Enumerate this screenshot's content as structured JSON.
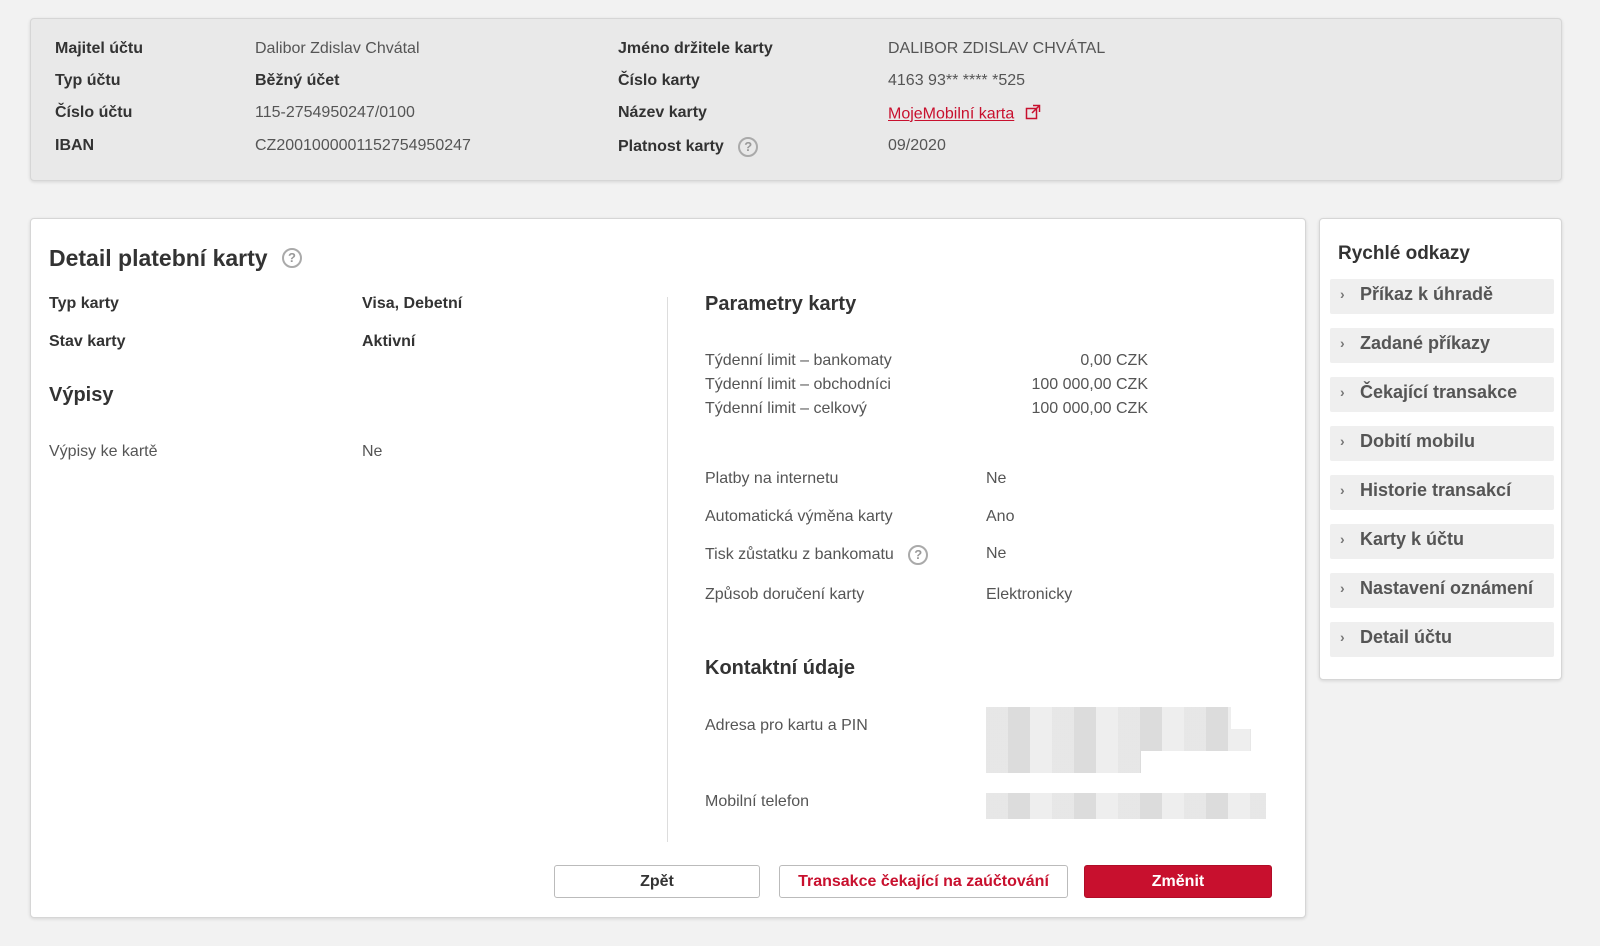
{
  "summary": {
    "owner_label": "Majitel účtu",
    "owner_value": "Dalibor Zdislav Chvátal",
    "type_label": "Typ účtu",
    "type_value": "Běžný účet",
    "number_label": "Číslo účtu",
    "number_value": "115-2754950247/0100",
    "iban_label": "IBAN",
    "iban_value": "CZ2001000001152754950247",
    "holder_label": "Jméno držitele karty",
    "holder_value": "DALIBOR ZDISLAV CHVÁTAL",
    "card_number_label": "Číslo karty",
    "card_number_value": "4163 93** **** *525",
    "card_name_label": "Název karty",
    "card_name_value": "MojeMobilní karta",
    "validity_label": "Platnost karty",
    "validity_value": "09/2020",
    "help_glyph": "?"
  },
  "detail": {
    "title": "Detail platební karty",
    "card_type_label": "Typ karty",
    "card_type_value": "Visa, Debetní",
    "card_state_label": "Stav karty",
    "card_state_value": "Aktivní",
    "statements_heading": "Výpisy",
    "statements_label": "Výpisy ke kartě",
    "statements_value": "Ne",
    "params_heading": "Parametry karty",
    "limits": [
      {
        "label": "Týdenní limit – bankomaty",
        "value": "0,00 CZK"
      },
      {
        "label": "Týdenní limit – obchodníci",
        "value": "100 000,00 CZK"
      },
      {
        "label": "Týdenní limit – celkový",
        "value": "100 000,00 CZK"
      }
    ],
    "params": [
      {
        "label": "Platby na internetu",
        "value": "Ne"
      },
      {
        "label": "Automatická výměna karty",
        "value": "Ano"
      },
      {
        "label": "Tisk zůstatku z bankomatu",
        "value": "Ne"
      },
      {
        "label": "Způsob doručení karty",
        "value": "Elektronicky"
      }
    ],
    "contact_heading": "Kontaktní údaje",
    "address_label": "Adresa pro kartu a PIN",
    "phone_label": "Mobilní telefon"
  },
  "buttons": {
    "back": "Zpět",
    "pending": "Transakce čekající na zaúčtování",
    "change": "Změnit"
  },
  "quick_links": {
    "title": "Rychlé odkazy",
    "items": [
      "Příkaz k úhradě",
      "Zadané příkazy",
      "Čekající transakce",
      "Dobití mobilu",
      "Historie transakcí",
      "Karty k účtu",
      "Nastavení oznámení",
      "Detail účtu"
    ],
    "chevron": "›"
  },
  "colors": {
    "accent_red": "#c8102e",
    "panel_bg": "#e9e9e9",
    "page_bg": "#f2f2f2"
  }
}
